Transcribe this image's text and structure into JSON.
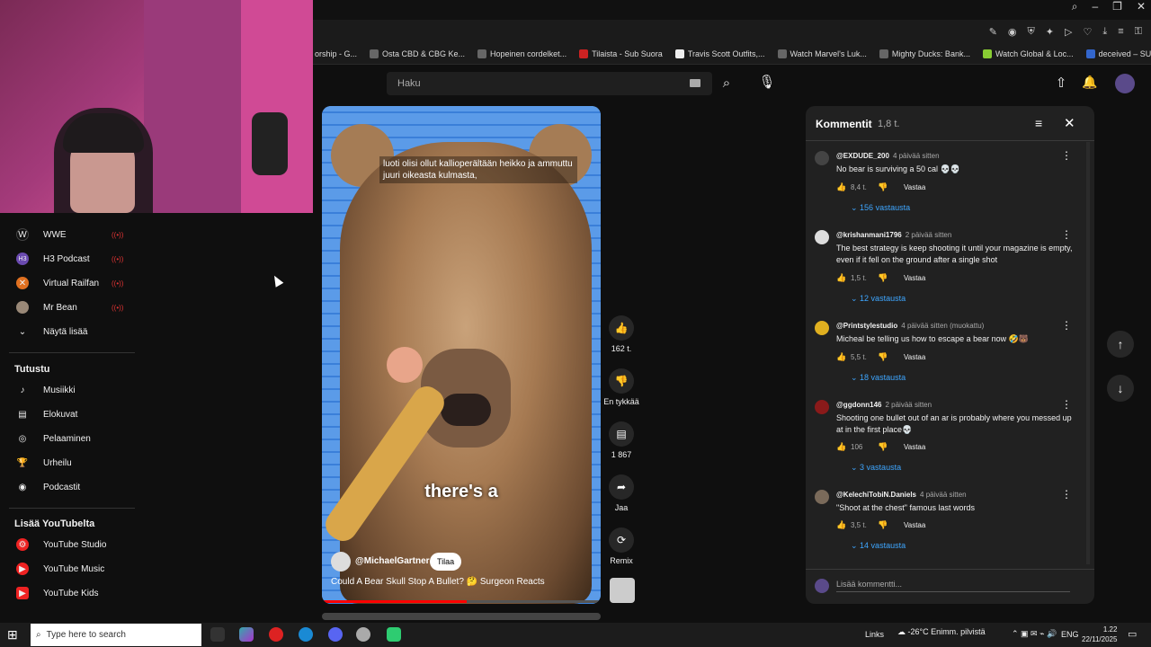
{
  "browser": {
    "bookmarks": [
      "orship - G...",
      "Osta CBD & CBG Ke...",
      "Hopeinen cordelket...",
      "Tilaista - Sub Suora",
      "Travis Scott Outfits,...",
      "Watch Marvel's Luk...",
      "Mighty Ducks: Bank...",
      "Watch Global & Loc...",
      "deceived – SUORAT..."
    ]
  },
  "header": {
    "search_placeholder": "Haku"
  },
  "sidebar": {
    "live_marker": "((•))",
    "subscriptions": [
      {
        "label": "WWE",
        "live": true
      },
      {
        "label": "H3 Podcast",
        "live": true
      },
      {
        "label": "Virtual Railfan",
        "live": true
      },
      {
        "label": "Mr Bean",
        "live": true
      }
    ],
    "show_more": "Näytä lisää",
    "explore_title": "Tutustu",
    "explore": [
      "Musiikki",
      "Elokuvat",
      "Pelaaminen",
      "Urheilu",
      "Podcastit"
    ],
    "more_title": "Lisää YouTubelta",
    "more": [
      "YouTube Studio",
      "YouTube Music",
      "YouTube Kids"
    ]
  },
  "video": {
    "caption_top": "luoti olisi ollut kallioperältään heikko ja ammuttu juuri oikeasta kulmasta,",
    "caption_big": "there's a",
    "channel": "@MichaelGartner",
    "subscribe": "Tilaa",
    "title": "Could A Bear Skull Stop A Bullet? 🤔 Surgeon Reacts",
    "progress": 0.52
  },
  "actions": {
    "likes": "162 t.",
    "dislike": "En tykkää",
    "comments": "1 867",
    "share": "Jaa",
    "remix": "Remix"
  },
  "comments": {
    "title": "Kommentit",
    "count": "1,8 t.",
    "reply_label": "Vastaa",
    "input_placeholder": "Lisää kommentti...",
    "items": [
      {
        "handle": "@EXDUDE_200",
        "time": "4 päivää sitten",
        "text": "No bear is surviving a 50 cal 💀💀",
        "likes": "8,4 t.",
        "replies": "156 vastausta",
        "color": "#444"
      },
      {
        "handle": "@krishanmani1796",
        "time": "2 päivää sitten",
        "text": "The best strategy is keep shooting it until your magazine is empty, even if it fell on the ground after a single shot",
        "likes": "1,5 t.",
        "replies": "12 vastausta",
        "color": "#ddd"
      },
      {
        "handle": "@Printstylestudio",
        "time": "4 päivää sitten (muokattu)",
        "text": "Micheal be telling us how to escape a bear now 🤣🐻",
        "likes": "5,5 t.",
        "replies": "18 vastausta",
        "color": "#e0b020"
      },
      {
        "handle": "@ggdonn146",
        "time": "2 päivää sitten",
        "text": "Shooting one bullet out of an ar is probably where you messed up at in the first place💀",
        "likes": "106",
        "replies": "3 vastausta",
        "color": "#8a1a1a"
      },
      {
        "handle": "@KelechiTobiN.Daniels",
        "time": "4 päivää sitten",
        "text": "\"Shoot at the chest\" famous last words",
        "likes": "3,5 t.",
        "replies": "14 vastausta",
        "color": "#7a6a5a"
      }
    ]
  },
  "taskbar": {
    "search_placeholder": "Type here to search",
    "links": "Links",
    "weather": "-26°C  Enimm. pilvistä",
    "lang": "ENG",
    "time": "1.22",
    "date": "22/11/2025"
  }
}
